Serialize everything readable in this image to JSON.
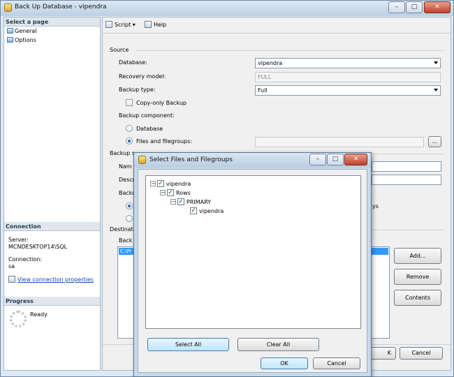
{
  "main_window": {
    "title": "Back Up Database - vipendra",
    "controls": {
      "minimize": "–",
      "maximize": "□",
      "close": "✕"
    }
  },
  "left_panel": {
    "select_page_header": "Select a page",
    "pages": [
      {
        "label": "General"
      },
      {
        "label": "Options"
      }
    ],
    "connection_header": "Connection",
    "server_label": "Server:",
    "server_value": "MCNDESKTOP14\\SQL",
    "connection_label": "Connection:",
    "connection_value": "sa",
    "view_properties_link": "View connection properties",
    "progress_header": "Progress",
    "progress_status": "Ready"
  },
  "toolbar": {
    "script_label": "Script",
    "help_label": "Help"
  },
  "form": {
    "source_header": "Source",
    "database_label": "Database:",
    "database_value": "vipendra",
    "recovery_model_label": "Recovery model:",
    "recovery_model_value": "FULL",
    "backup_type_label": "Backup type:",
    "backup_type_value": "Full",
    "copy_only_label": "Copy-only Backup",
    "backup_component_label": "Backup component:",
    "component_database_label": "Database",
    "component_files_label": "Files and filegroups:",
    "files_browse_label": "...",
    "backup_set_header_partial": "Backup s",
    "name_label_partial": "Nam",
    "description_label_partial": "Descr",
    "backup_expire_partial": "Backu",
    "destination_header_partial": "Destinati",
    "backup_to_partial": "Back",
    "destination_path_partial": "C:\\Pr",
    "suffix_text_partial": "ys",
    "add_button": "Add...",
    "remove_button": "Remove",
    "contents_button": "Contents",
    "ok_button_partial": "K",
    "cancel_button": "Cancel"
  },
  "dialog": {
    "title": "Select Files and Filegroups",
    "controls": {
      "minimize": "–",
      "maximize": "□",
      "close": "✕"
    },
    "tree": [
      {
        "label": "vipendra",
        "level": 0,
        "expander": "−",
        "checked": true
      },
      {
        "label": "Rows",
        "level": 1,
        "expander": "−",
        "checked": true
      },
      {
        "label": "PRIMARY",
        "level": 2,
        "expander": "−",
        "checked": true
      },
      {
        "label": "vipendra",
        "level": 3,
        "expander": "",
        "checked": true
      }
    ],
    "select_all_button": "Select All",
    "clear_all_button": "Clear All",
    "ok_button": "OK",
    "cancel_button": "Cancel"
  }
}
